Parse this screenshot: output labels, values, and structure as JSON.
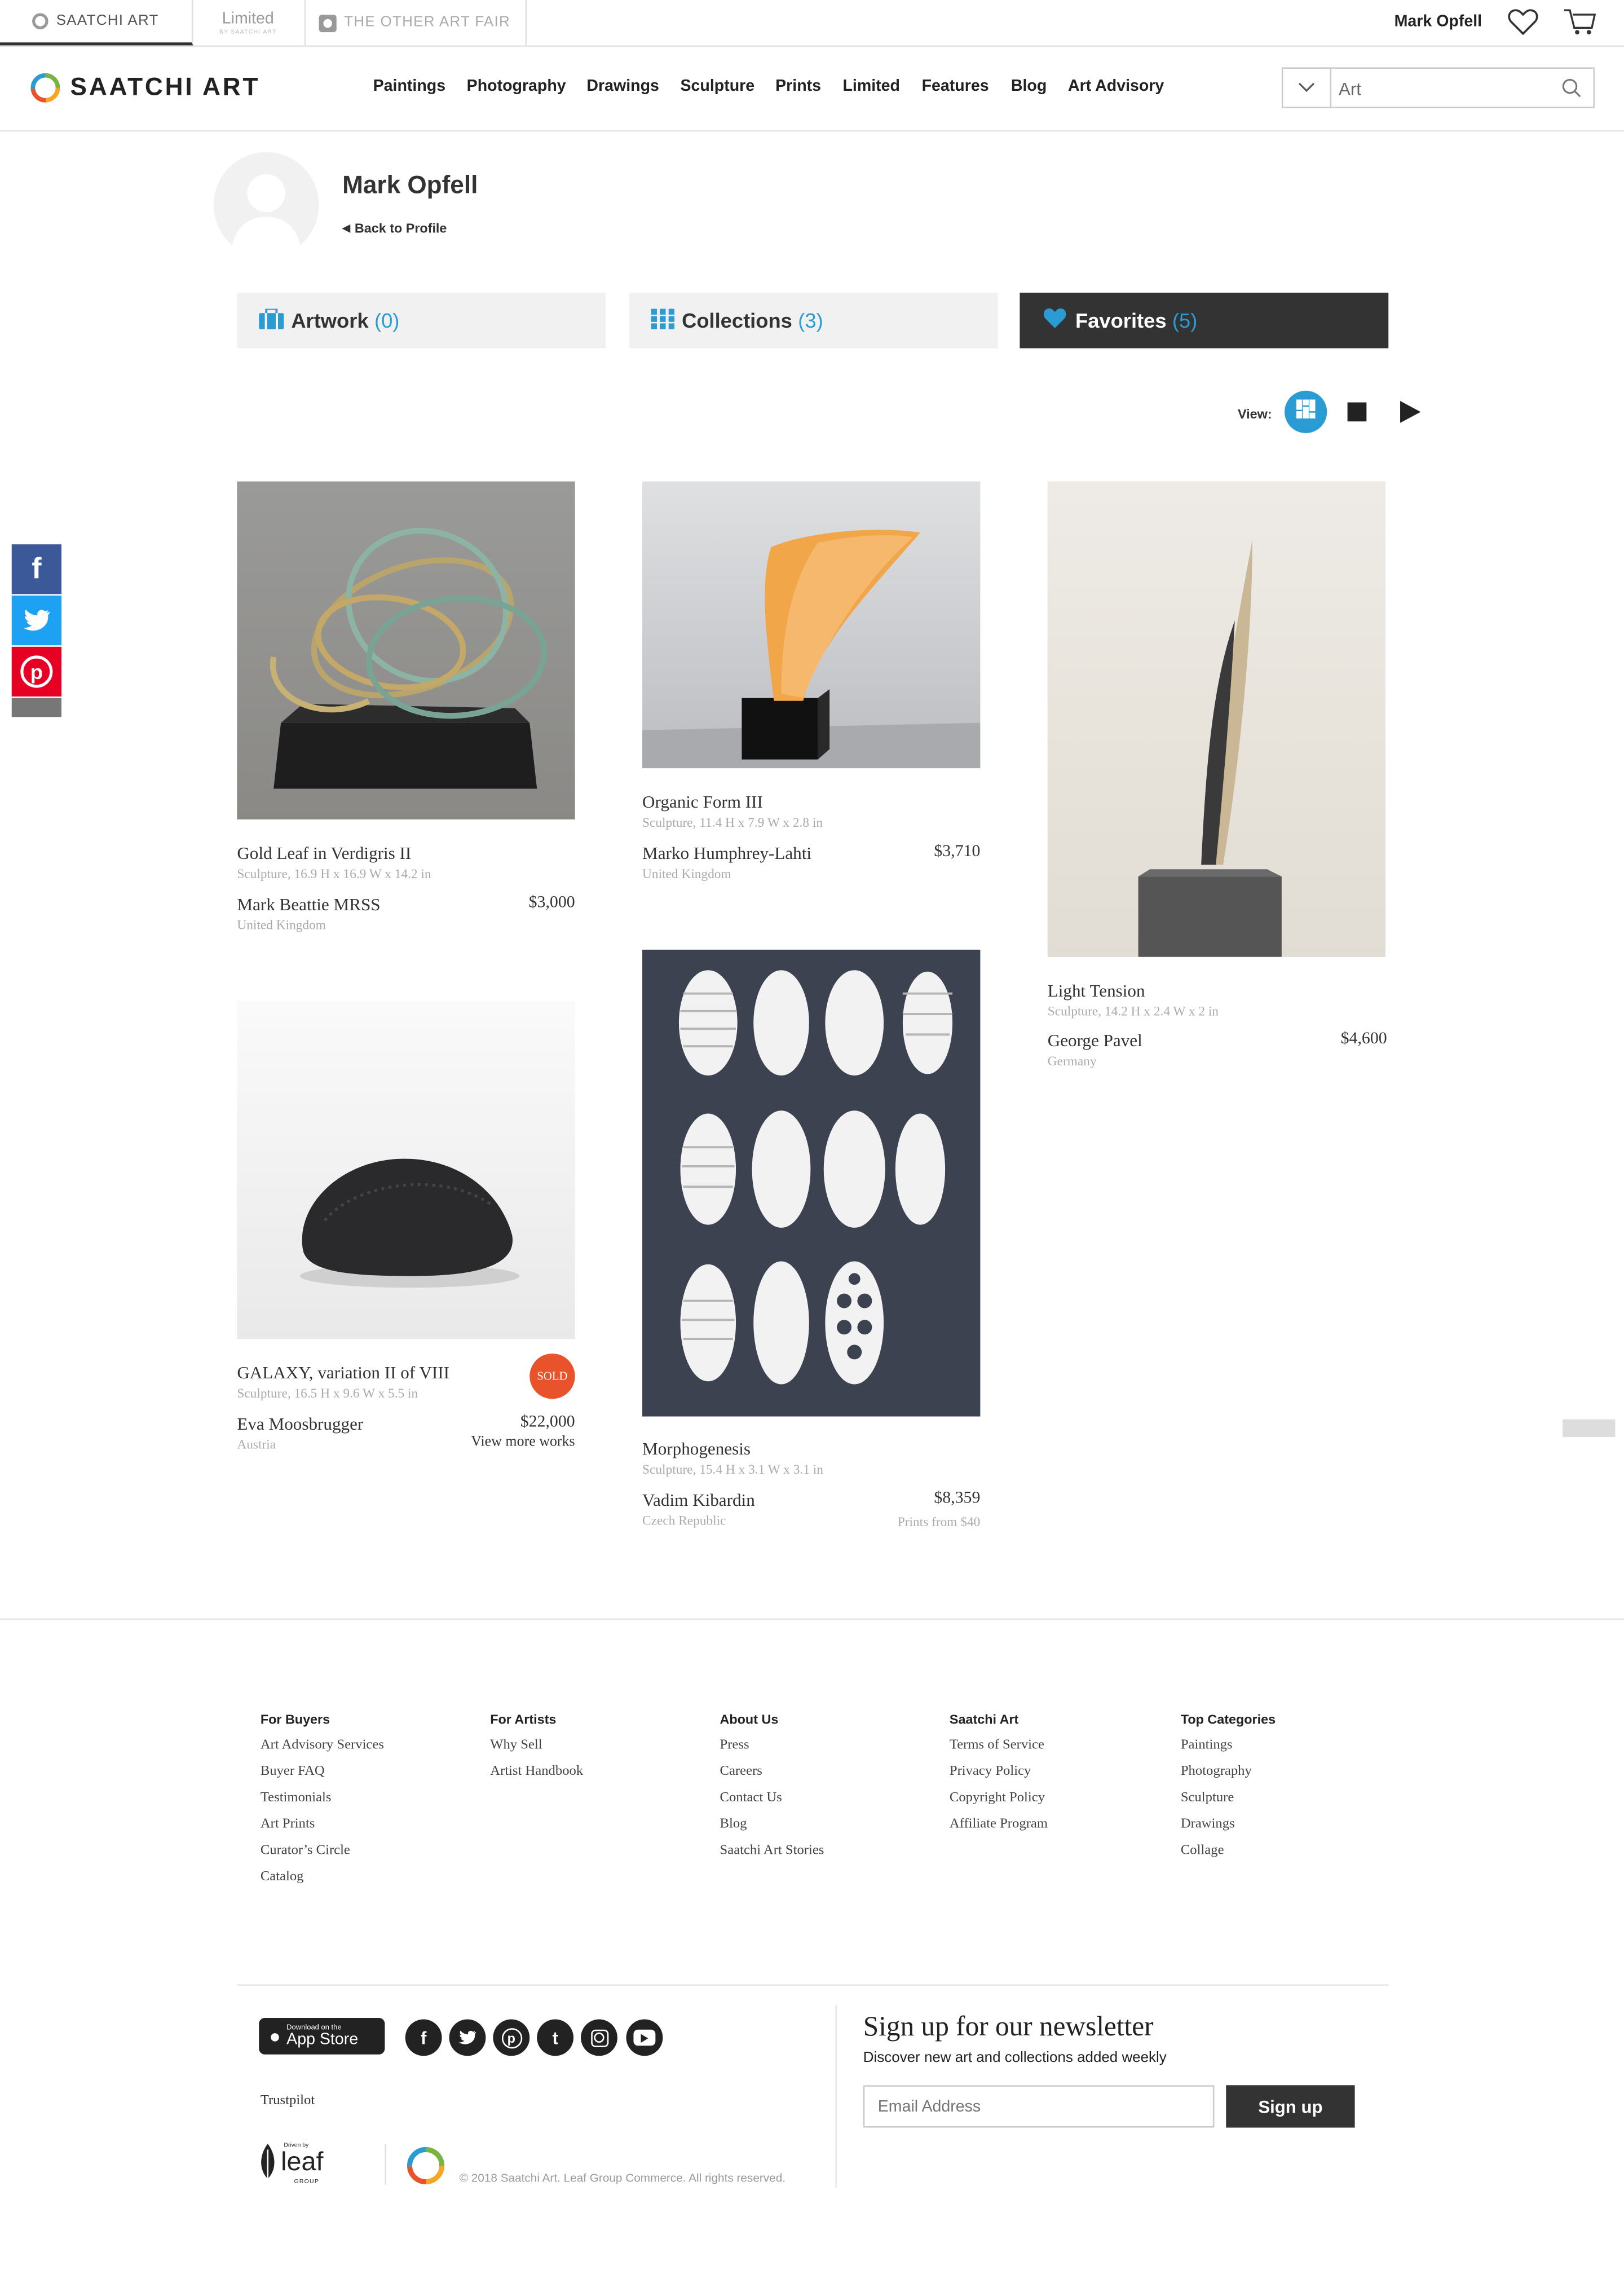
{
  "topbar": {
    "tabs": [
      "SAATCHI ART",
      "Limited",
      "THE OTHER ART FAIR"
    ],
    "limited_sub": "BY SAATCHI ART",
    "user_name": "Mark Opfell"
  },
  "header": {
    "logo": "SAATCHI ART",
    "nav": [
      "Paintings",
      "Photography",
      "Drawings",
      "Sculpture",
      "Prints",
      "Limited",
      "Features",
      "Blog",
      "Art Advisory"
    ],
    "search_value": "Art"
  },
  "profile": {
    "name": "Mark Opfell",
    "back_link": "Back to Profile",
    "tabs": [
      {
        "label": "Artwork",
        "count": "(0)"
      },
      {
        "label": "Collections",
        "count": "(3)"
      },
      {
        "label": "Favorites",
        "count": "(5)"
      }
    ],
    "view_label": "View:"
  },
  "artworks": [
    {
      "title": "Gold Leaf in Verdigris II",
      "meta": "Sculpture, 16.9 H x 16.9 W x 14.2 in",
      "artist": "Mark Beattie MRSS",
      "price": "$3,000",
      "location": "United Kingdom"
    },
    {
      "title": "Organic Form III",
      "meta": "Sculpture, 11.4 H x 7.9 W x 2.8 in",
      "artist": "Marko Humphrey-Lahti",
      "price": "$3,710",
      "location": "United Kingdom"
    },
    {
      "title": "Light Tension",
      "meta": "Sculpture, 14.2 H x 2.4 W x 2 in",
      "artist": "George Pavel",
      "price": "$4,600",
      "location": "Germany"
    },
    {
      "title": "GALAXY, variation II of VIII",
      "meta": "Sculpture, 16.5 H x 9.6 W x 5.5 in",
      "artist": "Eva Moosbrugger",
      "price": "$22,000",
      "location": "Austria",
      "extra": "View more works",
      "badge": "SOLD"
    },
    {
      "title": "Morphogenesis",
      "meta": "Sculpture, 15.4 H x 3.1 W x 3.1 in",
      "artist": "Vadim Kibardin",
      "price": "$8,359",
      "location": "Czech Republic",
      "extra": "Prints from $40"
    }
  ],
  "footer": {
    "columns": [
      {
        "heading": "For Buyers",
        "links": [
          "Art Advisory Services",
          "Buyer FAQ",
          "Testimonials",
          "Art Prints",
          "Curator’s Circle",
          "Catalog"
        ]
      },
      {
        "heading": "For Artists",
        "links": [
          "Why Sell",
          "Artist Handbook"
        ]
      },
      {
        "heading": "About Us",
        "links": [
          "Press",
          "Careers",
          "Contact Us",
          "Blog",
          "Saatchi Art Stories"
        ]
      },
      {
        "heading": "Saatchi Art",
        "links": [
          "Terms of Service",
          "Privacy Policy",
          "Copyright Policy",
          "Affiliate Program"
        ]
      },
      {
        "heading": "Top Categories",
        "links": [
          "Paintings",
          "Photography",
          "Sculpture",
          "Drawings",
          "Collage"
        ]
      }
    ],
    "appstore_small": "Download on the",
    "appstore_big": "App Store",
    "trustpilot": "Trustpilot",
    "leaf_small": "Driven by",
    "leaf_big": "leaf",
    "leaf_sub": "GROUP",
    "newsletter_title": "Sign up for our newsletter",
    "newsletter_sub": "Discover new art and collections added weekly",
    "email_placeholder": "Email Address",
    "signup_label": "Sign up",
    "copyright": "© 2018 Saatchi Art. Leaf Group Commerce. All rights reserved."
  },
  "colors": {
    "accent": "#2a9bd3",
    "dark": "#333333",
    "sold": "#e8532b",
    "facebook": "#3b5998",
    "twitter": "#1da1f2",
    "pinterest": "#e60023"
  }
}
